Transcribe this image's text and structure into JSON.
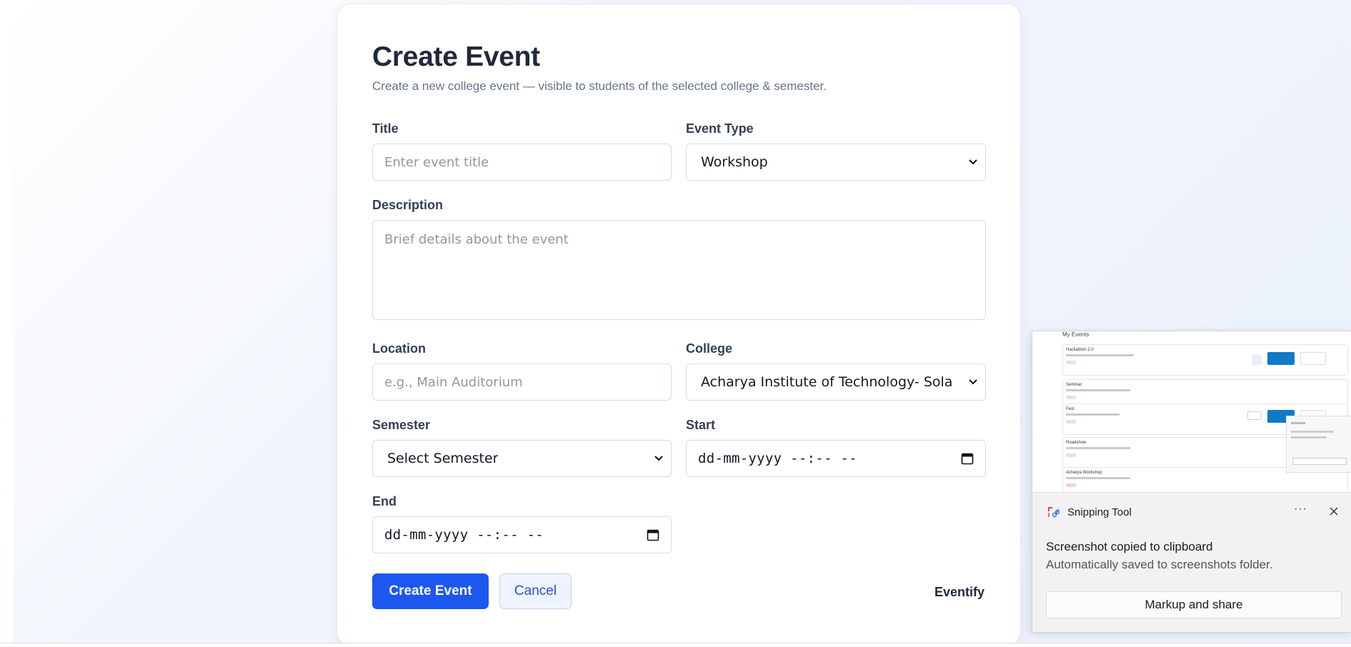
{
  "form": {
    "title": "Create Event",
    "subtitle": "Create a new college event — visible to students of the selected college & semester.",
    "title_field": {
      "label": "Title",
      "placeholder": "Enter event title"
    },
    "event_type": {
      "label": "Event Type",
      "value": "Workshop"
    },
    "description": {
      "label": "Description",
      "placeholder": "Brief details about the event"
    },
    "location": {
      "label": "Location",
      "placeholder": "e.g., Main Auditorium"
    },
    "college": {
      "label": "College",
      "value": "Acharya Institute of Technology- Soladevanahalli"
    },
    "semester": {
      "label": "Semester",
      "value": "Select Semester"
    },
    "start": {
      "label": "Start",
      "value": "dd-mm-yyyy --:-- --"
    },
    "end": {
      "label": "End",
      "value": "dd-mm-yyyy --:-- --"
    },
    "create_button": "Create Event",
    "cancel_button": "Cancel",
    "brand": "Eventify"
  },
  "notification": {
    "app_name": "Snipping Tool",
    "more_label": "···",
    "message": "Screenshot copied to clipboard",
    "sub_message": "Automatically saved to screenshots folder.",
    "action_button": "Markup and share",
    "preview": {
      "title": "My Events",
      "rows": [
        "Hackathon 2.0",
        "Seminar",
        "Fest",
        "Roadshow",
        "Acharya Workshop"
      ]
    }
  },
  "colors": {
    "primary": "#1c57f0",
    "text": "#1e293b",
    "muted": "#64748b"
  }
}
